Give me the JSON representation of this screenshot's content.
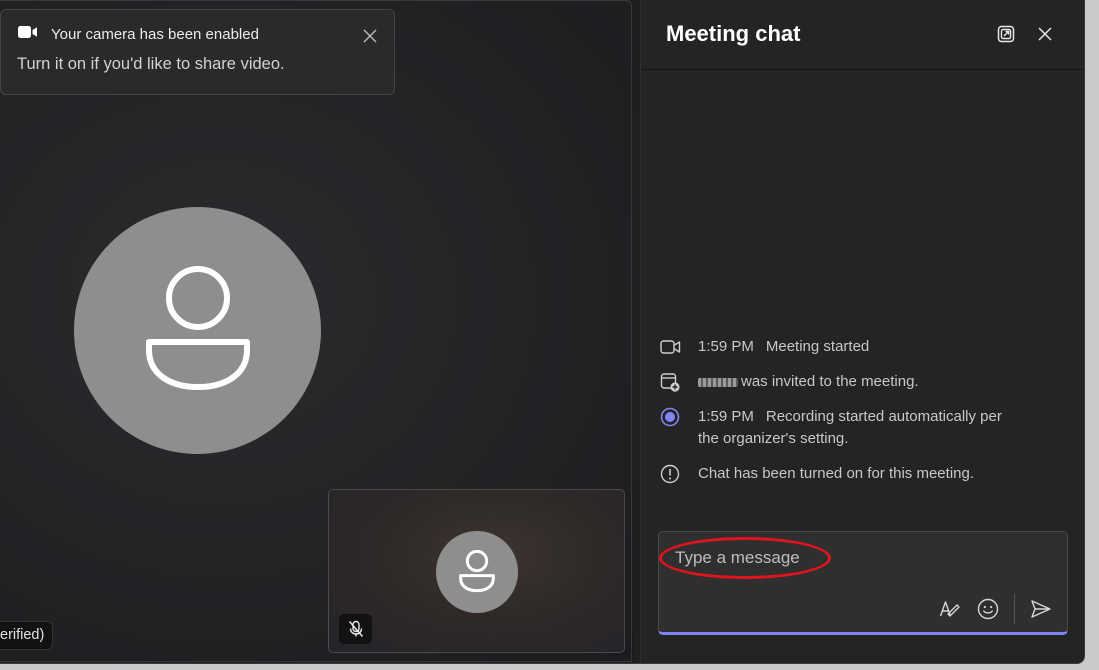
{
  "toast": {
    "title": "Your camera has been enabled",
    "body": "Turn it on if you'd like to share video.",
    "icon": "video-camera-icon"
  },
  "stage": {
    "participant_name_partial": "erified)"
  },
  "chat": {
    "title": "Meeting chat",
    "header_icons": [
      "pop-out-icon",
      "close-icon"
    ],
    "events": [
      {
        "icon": "video-camera-outline-icon",
        "time": "1:59 PM",
        "text": "Meeting started"
      },
      {
        "icon": "calendar-add-icon",
        "time": "",
        "text": "was invited to the meeting."
      },
      {
        "icon": "recording-dot-icon",
        "time": "1:59 PM",
        "text": "Recording started automatically per",
        "text2": "the organizer's setting."
      },
      {
        "icon": "info-circle-icon",
        "time": "",
        "text": "Chat has been turned on for this meeting."
      }
    ],
    "composer": {
      "placeholder": "Type a message",
      "tools": [
        "format-icon",
        "emoji-icon",
        "send-icon"
      ]
    }
  },
  "colors": {
    "accent": "#7f85f5",
    "highlight": "#e0141e",
    "avatar": "#8e8e8e"
  }
}
